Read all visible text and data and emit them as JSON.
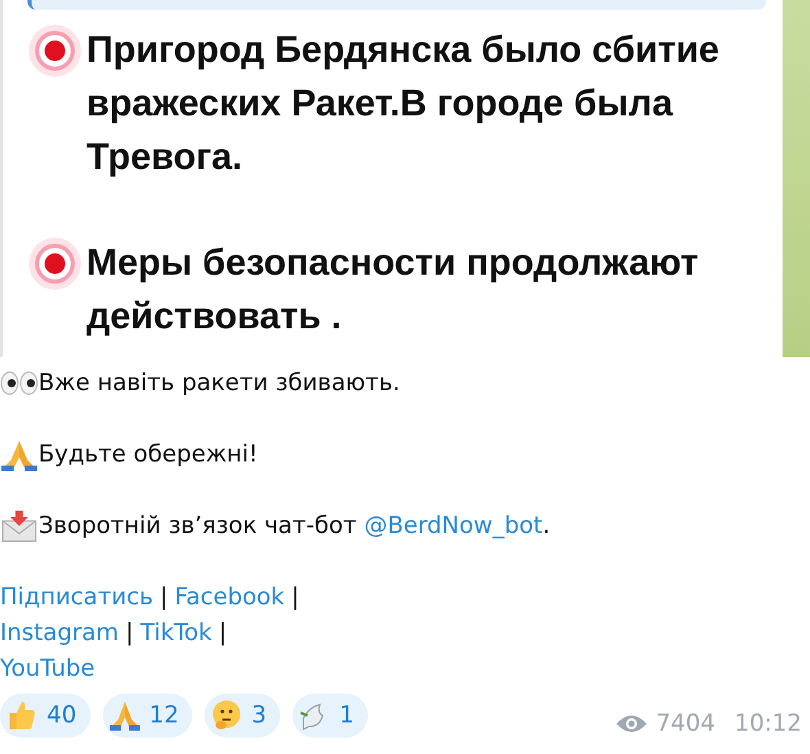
{
  "embedded_screenshot": {
    "paragraphs": [
      {
        "kind": "alert",
        "text": "Пригород Бердянска было сбитие вражеских Ракет.В городе была Тревога."
      },
      {
        "kind": "alert",
        "text": "Меры безопасности продолжают действовать ."
      }
    ]
  },
  "message": {
    "lines": [
      {
        "kind": "eyes",
        "text": "Вже навіть ракети збивають."
      },
      {
        "kind": "pray",
        "text": "Будьте обережні!"
      },
      {
        "kind": "envelope",
        "text": "Зворотній зв’язок чат-бот",
        "link": "@BerdNow_bot",
        "after": "."
      }
    ],
    "link_rows": [
      [
        {
          "kind": "link",
          "text": "Підписатись"
        },
        {
          "kind": "separator",
          "text": "|"
        },
        {
          "kind": "link",
          "text": "Facebook"
        },
        {
          "kind": "separator",
          "text": "|"
        }
      ],
      [
        {
          "kind": "link",
          "text": "Instagram"
        },
        {
          "kind": "separator",
          "text": "|"
        },
        {
          "kind": "link",
          "text": "TikTok"
        },
        {
          "kind": "separator",
          "text": "|"
        }
      ],
      [
        {
          "kind": "link",
          "text": "YouTube"
        }
      ]
    ],
    "reactions": [
      {
        "kind": "thumbs",
        "count": "40"
      },
      {
        "kind": "pray",
        "count": "12"
      },
      {
        "kind": "thinking",
        "count": "3"
      },
      {
        "kind": "dove",
        "count": "1"
      }
    ],
    "views": "7404",
    "time": "10:12"
  }
}
